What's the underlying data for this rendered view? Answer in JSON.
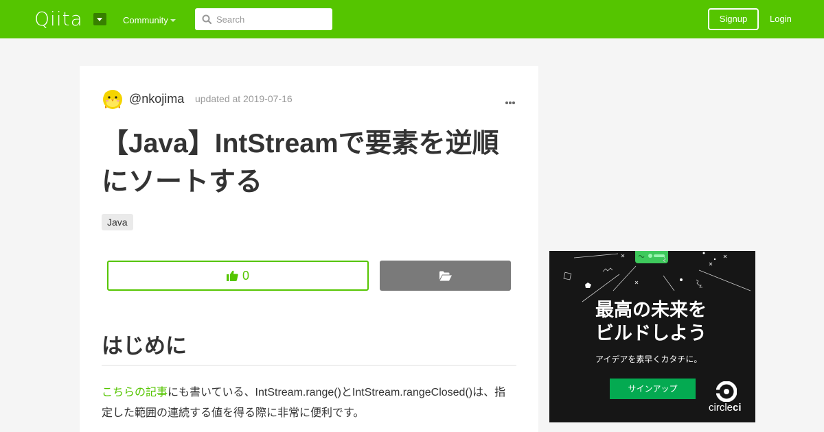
{
  "header": {
    "logo": "Qiita",
    "community_label": "Community",
    "search": {
      "placeholder": "Search",
      "value": ""
    },
    "signup_label": "Signup",
    "login_label": "Login",
    "brand_color": "#55c500"
  },
  "article": {
    "author": "@nkojima",
    "updated": "updated at 2019-07-16",
    "title": "【Java】IntStreamで要素を逆順にソートする",
    "tags": [
      "Java"
    ],
    "like_count": "0",
    "heading": "はじめに",
    "intro_link": "こちらの記事",
    "intro_text": "にも書いている、IntStream.range()とIntStream.rangeClosed()は、指定した範囲の連続する値を得る際に非常に便利です。"
  },
  "ad": {
    "headline_1": "最高の未来を",
    "headline_2": "ビルドしよう",
    "subtitle": "アイデアを素早くカタチに。",
    "button_label": "サインアップ",
    "brand_prefix": "circle",
    "brand_suffix": "ci",
    "button_color": "#04aa51"
  }
}
